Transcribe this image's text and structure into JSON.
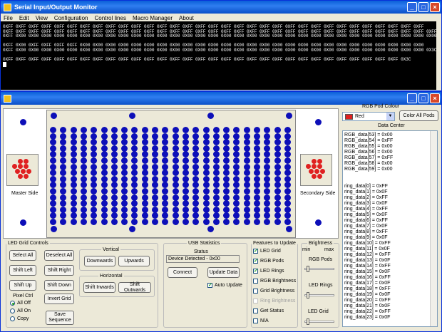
{
  "monitor": {
    "title": "Serial Input/Output Monitor",
    "menu": [
      "File",
      "Edit",
      "View",
      "Configuration",
      "Control lines",
      "Macro Manager",
      "About"
    ],
    "lines": [
      "0XFF 0XFF 0XFF 0XFF 0XFF 0XFF 0XFF 0XFF 0XFF 0XFF 0XFF 0XFF 0XFF 0XFF 0XFF 0XFF 0XFF 0XFF 0XFF 0XFF 0XFF 0XFF 0XFF 0XFF 0XFF 0XFF 0XFF 0XFF 0XFF 0XFF 0XFF 0XFF 0XFF",
      "0XFF 0XFF 0XFF 0XFF 0XFF 0XFF 0XFF 0XFF 0XFF 0XFF 0XFF 0XFF 0XFF 0XFF 0XFF 0XFF 0XFF 0XFF 0XFF 0XFF 0XFF 0XFF 0XFF 0XFF 0XFF 0XFF 0XFF 0XFF 0XFF 0XFF 0XFF 0XFF 0XFF 0XFF",
      "0XFF 0X00 0X00 0X00 0X00 0X00 0X00 0X00 0X00 0X00 0X00 0X00 0X00 0X00 0X00 0X00 0X00 0X00 0X00 0X00 0X00 0X00 0X00 0X00 0X00 0X00 0X00 0X00 0X00 0X00 0X00 0X00 0X00 0X00",
      "",
      "0XFF 0X00 0XFF 0XFF 0XFF 0XFF 0X00 0X00 0X00 0X00 0X00 0X00 0X00 0X00 0X00 0X00 0X00 0X00 0X00 0X00 0X00 0X00 0X00 0X00 0X00 0X00 0X00 0X00 0X00 0X00 0X00 0X00 0X00",
      "0XFF 0X00 0X00 0X00 0X00 0X00 0X00 0X00 0X00 0X00 0X00 0X00 0X00 0X00 0X00 0X00 0X00 0X00 0X00 0X00 0X00 0X00 0X00 0X00 0X00 0X00 0X00 0X00 0X00 0X00 0X00 0X00 0X00 0X3C",
      "",
      "0XFF 0XFF 0XFF 0XFF 0XFF 0XFF 0XFF 0XFF 0XFF 0XFF 0XFF 0XFF 0XFF 0XFF 0XFF 0XFF 0XFF 0XFF 0XFF 0XFF 0XFF 0XFF 0XFF 0XFF 0XFF 0XFF 0XFF 0XFF 0XFF 0XFF 0XFF 0X3C"
    ]
  },
  "app": {
    "master_side": "Master Side",
    "secondary_side": "Secondary Side",
    "grid": {
      "rows": 16,
      "cols": 24
    },
    "rgb_pod": {
      "label": "RGB Pod Colour",
      "selected": "Red",
      "selected_color": "#e02020",
      "color_all_button": "Color All Pods"
    },
    "data_center": {
      "label": "Data Center",
      "top": [
        "RGB_data[53] = 0x00",
        "RGB_data[54] = 0xFF",
        "RGB_data[55] = 0x00",
        "RGB_data[56] = 0x00",
        "RGB_data[57] = 0xFF",
        "RGB_data[58] = 0x00",
        "RGB_data[59] = 0x00"
      ],
      "bottom": [
        "ring_data[0]  = 0xFF",
        "ring_data[1]  = 0x0F",
        "ring_data[2]  = 0xFF",
        "ring_data[3]  = 0x0F",
        "ring_data[4]  = 0xFF",
        "ring_data[5]  = 0x0F",
        "ring_data[6]  = 0xFF",
        "ring_data[7]  = 0x0F",
        "ring_data[8]  = 0xFF",
        "ring_data[9]  = 0x0F",
        "ring_data[10] = 0xFF",
        "ring_data[11] = 0x0F",
        "ring_data[12] = 0xFF",
        "ring_data[13] = 0x0F",
        "ring_data[14] = 0xFF",
        "ring_data[15] = 0x0F",
        "ring_data[16] = 0xFF",
        "ring_data[17] = 0x0F",
        "ring_data[18] = 0xFF",
        "ring_data[19] = 0x0F",
        "ring_data[20] = 0xFF",
        "ring_data[21] = 0x0F",
        "ring_data[22] = 0xFF",
        "ring_data[23] = 0x0F"
      ]
    },
    "led_controls": {
      "label": "LED Grid Controls",
      "select_all": "Select All",
      "deselect_all": "Deselect All",
      "shift_left": "Shift Left",
      "shift_right": "Shift Right",
      "shift_up": "Shift Up",
      "shift_down": "Shift Down",
      "invert_grid": "Invert Grid",
      "vertical_label": "Vertical",
      "downwards": "Downwards",
      "upwards": "Upwards",
      "horizontal_label": "Horizontal",
      "shift_inwards": "Shift Inwards",
      "shift_outwards": "Shift Outwards",
      "pixel_ctrl_label": "Pixel Ctrl",
      "pixel_options": [
        "All Off",
        "All On",
        "Copy"
      ],
      "pixel_selected": 0,
      "save_sequence": "Save Sequence"
    },
    "usb": {
      "label": "USB Statistics",
      "status_label": "Status",
      "status_value": "Device Detected - 0x00",
      "connect": "Connect",
      "update_data": "Update Data",
      "auto_update": "Auto Update",
      "auto_update_checked": true
    },
    "features": {
      "label": "Features to Update",
      "items": [
        {
          "label": "LED Grid",
          "checked": true,
          "disabled": false
        },
        {
          "label": "RGB Pods",
          "checked": true,
          "disabled": false
        },
        {
          "label": "LED Rings",
          "checked": true,
          "disabled": false
        },
        {
          "label": "RGB Brightness",
          "checked": false,
          "disabled": false
        },
        {
          "label": "Grid Brightness",
          "checked": false,
          "disabled": false
        },
        {
          "label": "Ring Brightness",
          "checked": false,
          "disabled": true
        },
        {
          "label": "Get Status",
          "checked": false,
          "disabled": false
        },
        {
          "label": "N/A",
          "checked": false,
          "disabled": false
        }
      ]
    },
    "brightness": {
      "label": "Brightness",
      "min": "min",
      "max": "max",
      "rgb_pods": "RGB Pods",
      "led_rings": "LED Rings",
      "led_grid": "LED Grid",
      "rgb_level": 0.05,
      "rings_level": 0.05,
      "grid_level": 0.05
    }
  }
}
